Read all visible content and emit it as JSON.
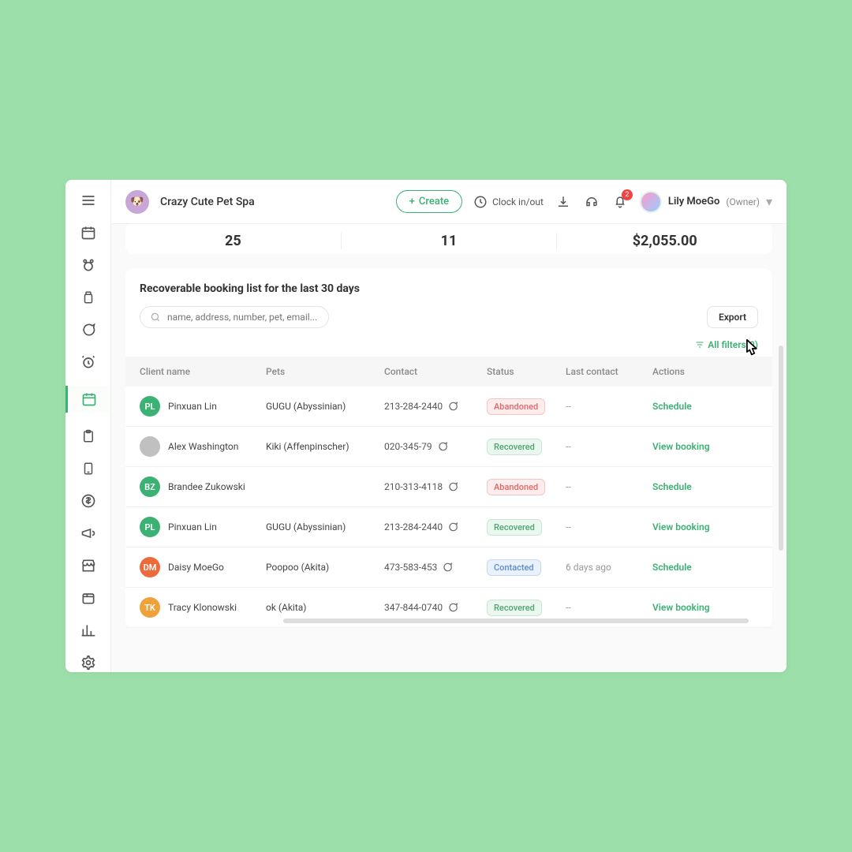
{
  "header": {
    "business_name": "Crazy Cute Pet Spa",
    "create_label": "Create",
    "clock_label": "Clock in/out",
    "notification_count": "2",
    "user_name": "Lily MoeGo",
    "user_role": "(Owner)"
  },
  "stats": {
    "a": "25",
    "b": "11",
    "c": "$2,055.00"
  },
  "panel": {
    "title": "Recoverable booking list for the last 30 days",
    "search_placeholder": "name, address, number, pet, email...",
    "export_label": "Export",
    "filters_label": "All filters(0)"
  },
  "columns": {
    "c1": "Client name",
    "c2": "Pets",
    "c3": "Contact",
    "c4": "Status",
    "c5": "Last contact",
    "c6": "Actions"
  },
  "rows": [
    {
      "initials": "PL",
      "avbg": "#3bb273",
      "name": "Pinxuan Lin",
      "pets": "GUGU (Abyssinian)",
      "contact": "213-284-2440",
      "status": "Abandoned",
      "last": "--",
      "action": "Schedule"
    },
    {
      "initials": "",
      "avbg": "#c0c0c0",
      "avimg": true,
      "name": "Alex Washington",
      "pets": "Kiki (Affenpinscher)",
      "contact": "020-345-79",
      "status": "Recovered",
      "last": "--",
      "action": "View booking"
    },
    {
      "initials": "BZ",
      "avbg": "#3bb273",
      "name": "Brandee Zukowski",
      "pets": "",
      "contact": "210-313-4118",
      "status": "Abandoned",
      "last": "--",
      "action": "Schedule"
    },
    {
      "initials": "PL",
      "avbg": "#3bb273",
      "name": "Pinxuan Lin",
      "pets": "GUGU (Abyssinian)",
      "contact": "213-284-2440",
      "status": "Recovered",
      "last": "--",
      "action": "View booking"
    },
    {
      "initials": "DM",
      "avbg": "#ef6a3a",
      "name": "Daisy MoeGo",
      "pets": "Poopoo (Akita)",
      "contact": "473-583-453",
      "status": "Contacted",
      "last": "6 days ago",
      "action": "Schedule"
    },
    {
      "initials": "TK",
      "avbg": "#f0a23a",
      "name": "Tracy Klonowski",
      "pets": "ok (Akita)",
      "contact": "347-844-0740",
      "status": "Recovered",
      "last": "--",
      "action": "View booking"
    }
  ]
}
